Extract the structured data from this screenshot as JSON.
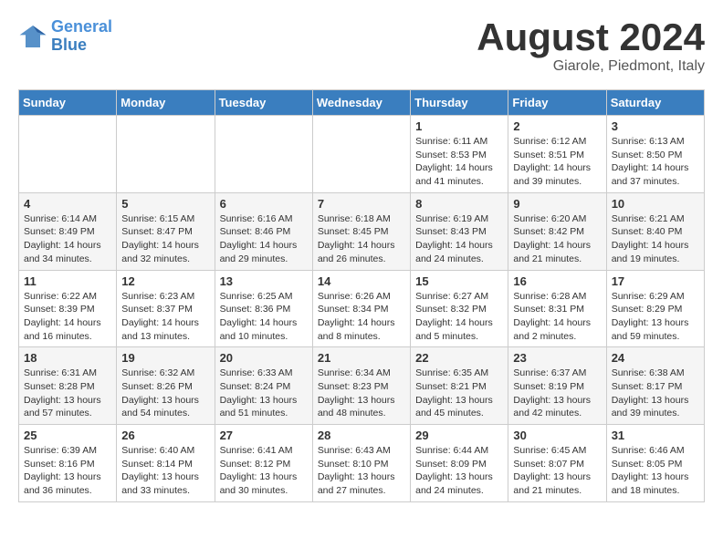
{
  "header": {
    "logo_line1": "General",
    "logo_line2": "Blue",
    "month_title": "August 2024",
    "location": "Giarole, Piedmont, Italy"
  },
  "weekdays": [
    "Sunday",
    "Monday",
    "Tuesday",
    "Wednesday",
    "Thursday",
    "Friday",
    "Saturday"
  ],
  "weeks": [
    [
      {
        "day": "",
        "info": ""
      },
      {
        "day": "",
        "info": ""
      },
      {
        "day": "",
        "info": ""
      },
      {
        "day": "",
        "info": ""
      },
      {
        "day": "1",
        "info": "Sunrise: 6:11 AM\nSunset: 8:53 PM\nDaylight: 14 hours and 41 minutes."
      },
      {
        "day": "2",
        "info": "Sunrise: 6:12 AM\nSunset: 8:51 PM\nDaylight: 14 hours and 39 minutes."
      },
      {
        "day": "3",
        "info": "Sunrise: 6:13 AM\nSunset: 8:50 PM\nDaylight: 14 hours and 37 minutes."
      }
    ],
    [
      {
        "day": "4",
        "info": "Sunrise: 6:14 AM\nSunset: 8:49 PM\nDaylight: 14 hours and 34 minutes."
      },
      {
        "day": "5",
        "info": "Sunrise: 6:15 AM\nSunset: 8:47 PM\nDaylight: 14 hours and 32 minutes."
      },
      {
        "day": "6",
        "info": "Sunrise: 6:16 AM\nSunset: 8:46 PM\nDaylight: 14 hours and 29 minutes."
      },
      {
        "day": "7",
        "info": "Sunrise: 6:18 AM\nSunset: 8:45 PM\nDaylight: 14 hours and 26 minutes."
      },
      {
        "day": "8",
        "info": "Sunrise: 6:19 AM\nSunset: 8:43 PM\nDaylight: 14 hours and 24 minutes."
      },
      {
        "day": "9",
        "info": "Sunrise: 6:20 AM\nSunset: 8:42 PM\nDaylight: 14 hours and 21 minutes."
      },
      {
        "day": "10",
        "info": "Sunrise: 6:21 AM\nSunset: 8:40 PM\nDaylight: 14 hours and 19 minutes."
      }
    ],
    [
      {
        "day": "11",
        "info": "Sunrise: 6:22 AM\nSunset: 8:39 PM\nDaylight: 14 hours and 16 minutes."
      },
      {
        "day": "12",
        "info": "Sunrise: 6:23 AM\nSunset: 8:37 PM\nDaylight: 14 hours and 13 minutes."
      },
      {
        "day": "13",
        "info": "Sunrise: 6:25 AM\nSunset: 8:36 PM\nDaylight: 14 hours and 10 minutes."
      },
      {
        "day": "14",
        "info": "Sunrise: 6:26 AM\nSunset: 8:34 PM\nDaylight: 14 hours and 8 minutes."
      },
      {
        "day": "15",
        "info": "Sunrise: 6:27 AM\nSunset: 8:32 PM\nDaylight: 14 hours and 5 minutes."
      },
      {
        "day": "16",
        "info": "Sunrise: 6:28 AM\nSunset: 8:31 PM\nDaylight: 14 hours and 2 minutes."
      },
      {
        "day": "17",
        "info": "Sunrise: 6:29 AM\nSunset: 8:29 PM\nDaylight: 13 hours and 59 minutes."
      }
    ],
    [
      {
        "day": "18",
        "info": "Sunrise: 6:31 AM\nSunset: 8:28 PM\nDaylight: 13 hours and 57 minutes."
      },
      {
        "day": "19",
        "info": "Sunrise: 6:32 AM\nSunset: 8:26 PM\nDaylight: 13 hours and 54 minutes."
      },
      {
        "day": "20",
        "info": "Sunrise: 6:33 AM\nSunset: 8:24 PM\nDaylight: 13 hours and 51 minutes."
      },
      {
        "day": "21",
        "info": "Sunrise: 6:34 AM\nSunset: 8:23 PM\nDaylight: 13 hours and 48 minutes."
      },
      {
        "day": "22",
        "info": "Sunrise: 6:35 AM\nSunset: 8:21 PM\nDaylight: 13 hours and 45 minutes."
      },
      {
        "day": "23",
        "info": "Sunrise: 6:37 AM\nSunset: 8:19 PM\nDaylight: 13 hours and 42 minutes."
      },
      {
        "day": "24",
        "info": "Sunrise: 6:38 AM\nSunset: 8:17 PM\nDaylight: 13 hours and 39 minutes."
      }
    ],
    [
      {
        "day": "25",
        "info": "Sunrise: 6:39 AM\nSunset: 8:16 PM\nDaylight: 13 hours and 36 minutes."
      },
      {
        "day": "26",
        "info": "Sunrise: 6:40 AM\nSunset: 8:14 PM\nDaylight: 13 hours and 33 minutes."
      },
      {
        "day": "27",
        "info": "Sunrise: 6:41 AM\nSunset: 8:12 PM\nDaylight: 13 hours and 30 minutes."
      },
      {
        "day": "28",
        "info": "Sunrise: 6:43 AM\nSunset: 8:10 PM\nDaylight: 13 hours and 27 minutes."
      },
      {
        "day": "29",
        "info": "Sunrise: 6:44 AM\nSunset: 8:09 PM\nDaylight: 13 hours and 24 minutes."
      },
      {
        "day": "30",
        "info": "Sunrise: 6:45 AM\nSunset: 8:07 PM\nDaylight: 13 hours and 21 minutes."
      },
      {
        "day": "31",
        "info": "Sunrise: 6:46 AM\nSunset: 8:05 PM\nDaylight: 13 hours and 18 minutes."
      }
    ]
  ]
}
